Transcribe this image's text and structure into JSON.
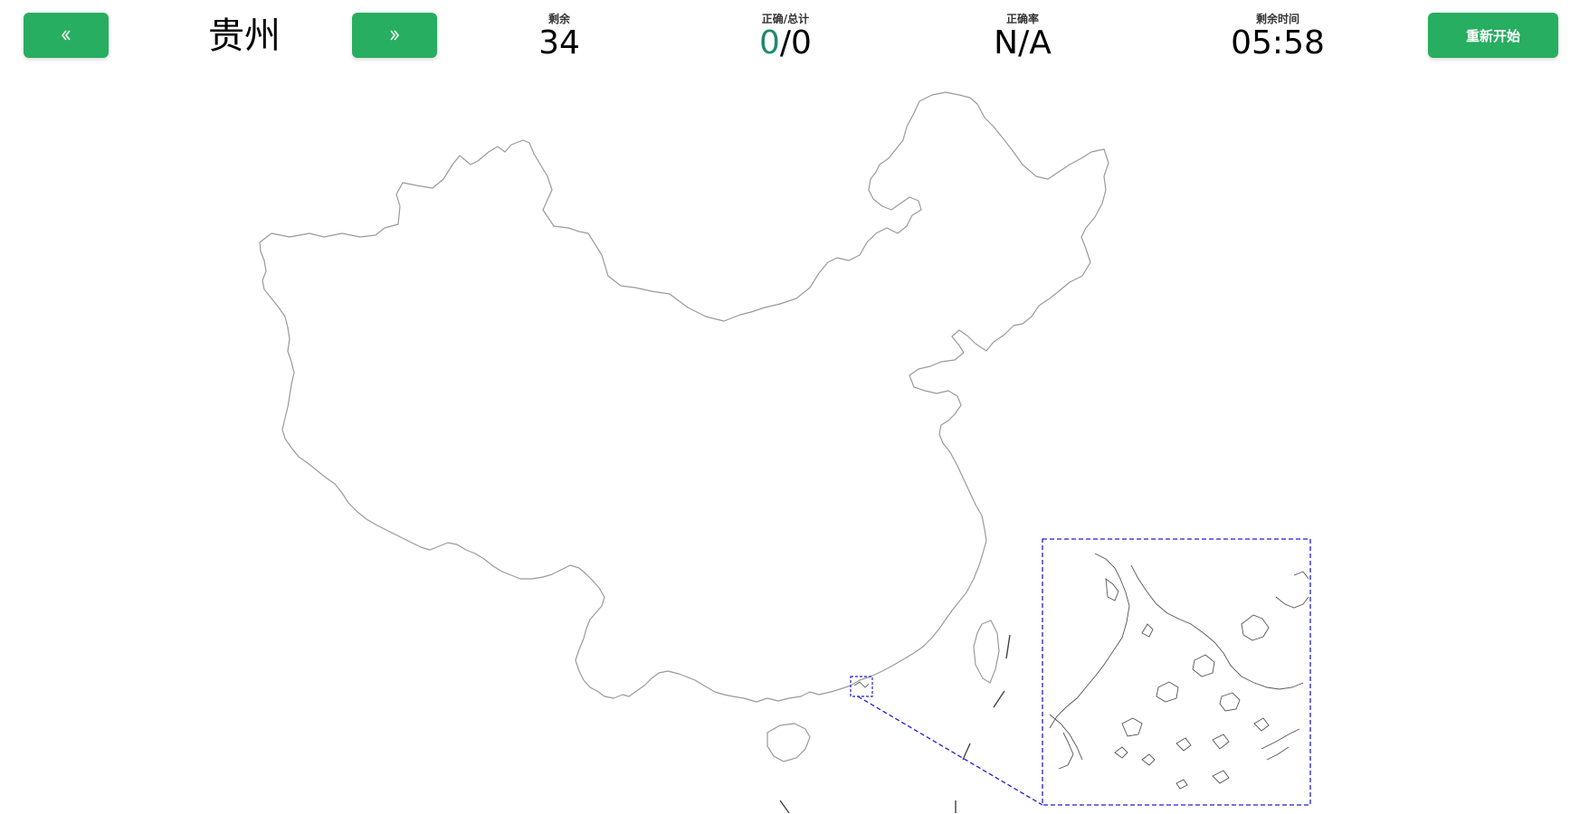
{
  "header": {
    "prev_icon": "double-chevron-left-icon",
    "next_icon": "double-chevron-right-icon",
    "province": "贵州",
    "restart_label": "重新开始"
  },
  "stats": {
    "remaining_label": "剩余",
    "remaining_value": "34",
    "score_label": "正确/总计",
    "score_correct": "0",
    "score_sep_total": "/0",
    "rate_label": "正确率",
    "rate_value": "N/A",
    "time_label": "剩余时间",
    "time_value": "05:58"
  },
  "colors": {
    "button_green": "#27ae60",
    "correct_teal": "#1e8a6a",
    "map_outline": "#9a9a9a",
    "inset_dash": "#1f1fd6"
  }
}
